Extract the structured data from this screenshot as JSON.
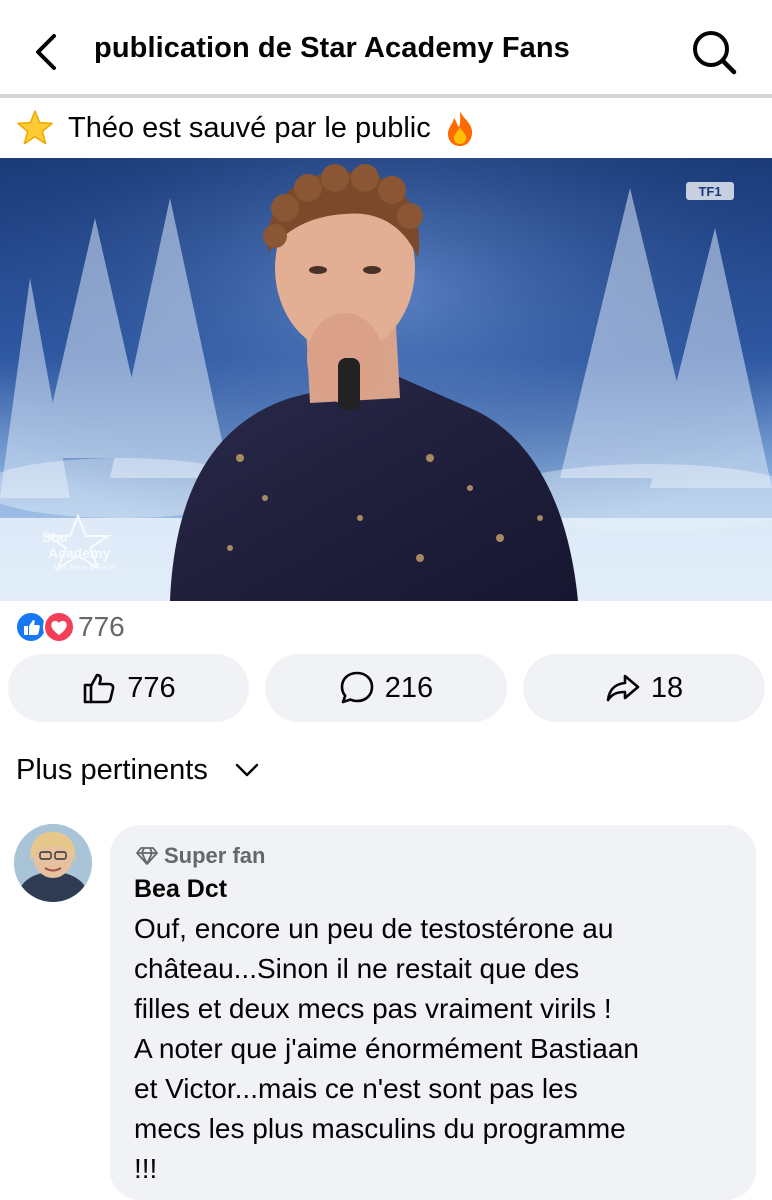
{
  "header": {
    "title": "publication de Star Academy Fans",
    "back_icon": "chevron-left-icon",
    "search_icon": "search-icon"
  },
  "post": {
    "caption": "Théo est sauvé par le public",
    "caption_emoji_left": "star-emoji",
    "caption_emoji_right": "fire-emoji",
    "media": {
      "channel_logo": "TF1",
      "show_logo_line1": "Star",
      "show_logo_line2": "Academy",
      "show_logo_sub": "Les Face-à-Face"
    },
    "reactions": {
      "types": [
        "like-icon",
        "love-icon"
      ],
      "count": "776"
    },
    "actions": {
      "like_count": "776",
      "comment_count": "216",
      "share_count": "18"
    }
  },
  "comments": {
    "sort_label": "Plus pertinents",
    "items": [
      {
        "badge": "Super fan",
        "author": "Bea Dct",
        "lines": [
          "Ouf, encore un peu de testostérone au",
          "château...Sinon il ne restait que des",
          "filles et deux mecs pas vraiment virils !",
          "A noter que j'aime énormément Bastiaan",
          "et Victor...mais ce n'est sont pas les",
          "mecs les plus masculins du programme",
          "!!!"
        ]
      }
    ]
  },
  "colors": {
    "accent_blue": "#1877f2",
    "love_red": "#f33e58",
    "pill_bg": "#f0f2f5",
    "secondary_text": "#65676b"
  }
}
